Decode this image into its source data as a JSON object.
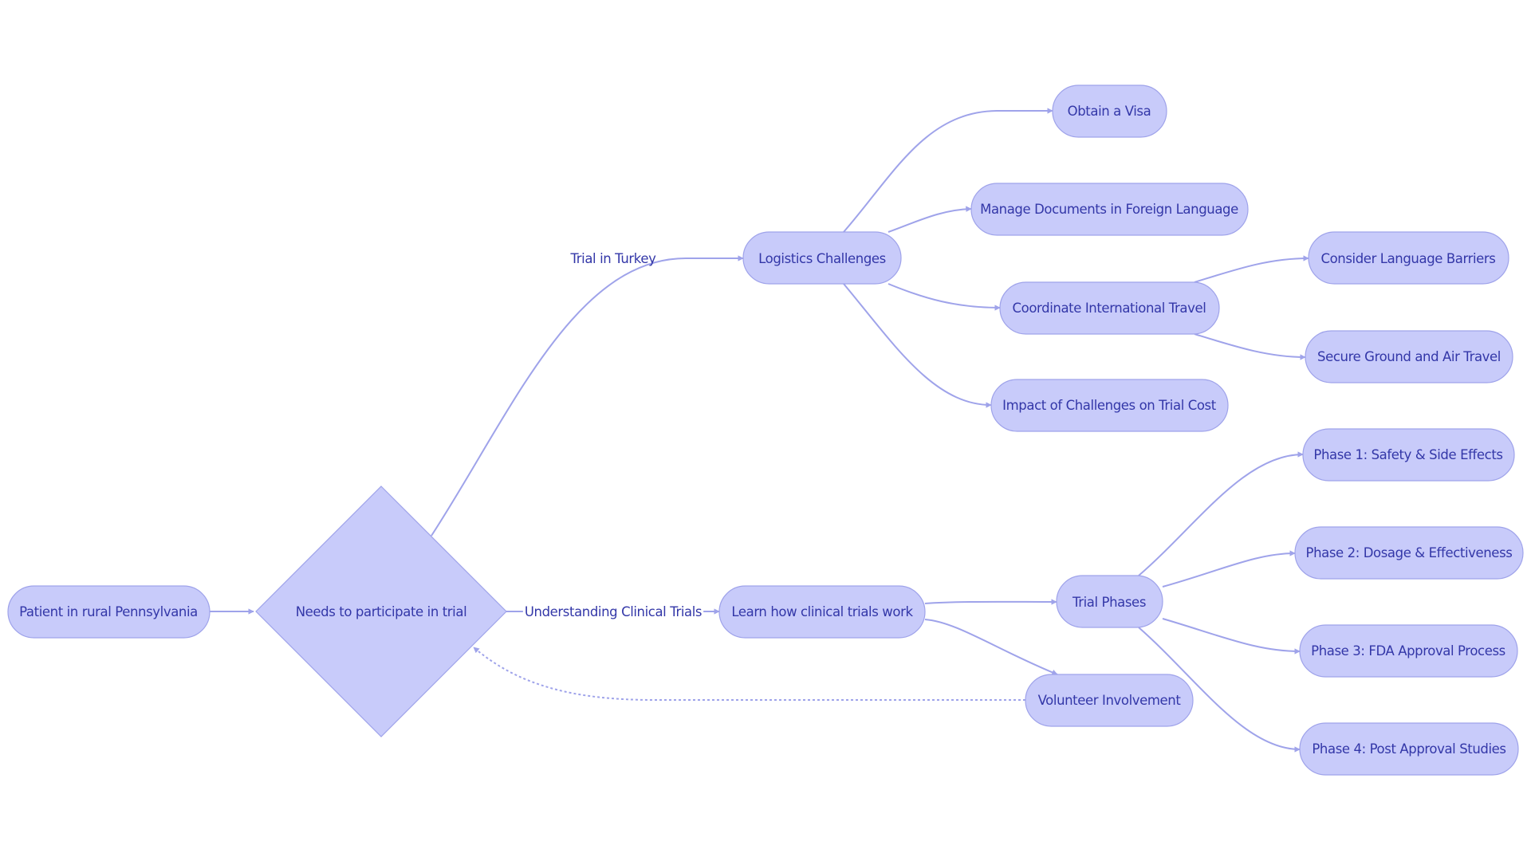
{
  "diagram": {
    "type": "flowchart",
    "colors": {
      "node_fill": "#c8cbfa",
      "node_stroke": "#9fa3ea",
      "edge": "#9fa3ea",
      "text": "#3337a8",
      "background": "#ffffff"
    },
    "nodes": {
      "patient": {
        "label": "Patient in rural Pennsylvania",
        "shape": "stadium"
      },
      "decision": {
        "label": "Needs to participate in trial",
        "shape": "diamond"
      },
      "logistics": {
        "label": "Logistics Challenges",
        "shape": "stadium"
      },
      "learn": {
        "label": "Learn how clinical trials work",
        "shape": "stadium"
      },
      "visa": {
        "label": "Obtain a Visa",
        "shape": "stadium"
      },
      "documents": {
        "label": "Manage Documents in Foreign Language",
        "shape": "stadium"
      },
      "coordinate": {
        "label": "Coordinate International Travel",
        "shape": "stadium"
      },
      "impact": {
        "label": "Impact of Challenges on Trial Cost",
        "shape": "stadium"
      },
      "language": {
        "label": "Consider Language Barriers",
        "shape": "stadium"
      },
      "secure": {
        "label": "Secure Ground and Air Travel",
        "shape": "stadium"
      },
      "phases": {
        "label": "Trial Phases",
        "shape": "stadium"
      },
      "volunteer": {
        "label": "Volunteer Involvement",
        "shape": "stadium"
      },
      "phase1": {
        "label": "Phase 1: Safety & Side Effects",
        "shape": "stadium"
      },
      "phase2": {
        "label": "Phase 2: Dosage & Effectiveness",
        "shape": "stadium"
      },
      "phase3": {
        "label": "Phase 3: FDA Approval Process",
        "shape": "stadium"
      },
      "phase4": {
        "label": "Phase 4: Post Approval Studies",
        "shape": "stadium"
      }
    },
    "edges": [
      {
        "from": "patient",
        "to": "decision",
        "label": "",
        "style": "solid"
      },
      {
        "from": "decision",
        "to": "logistics",
        "label": "Trial in Turkey",
        "style": "solid"
      },
      {
        "from": "decision",
        "to": "learn",
        "label": "Understanding Clinical Trials",
        "style": "solid"
      },
      {
        "from": "logistics",
        "to": "visa",
        "label": "",
        "style": "solid"
      },
      {
        "from": "logistics",
        "to": "documents",
        "label": "",
        "style": "solid"
      },
      {
        "from": "logistics",
        "to": "coordinate",
        "label": "",
        "style": "solid"
      },
      {
        "from": "logistics",
        "to": "impact",
        "label": "",
        "style": "solid"
      },
      {
        "from": "coordinate",
        "to": "language",
        "label": "",
        "style": "solid"
      },
      {
        "from": "coordinate",
        "to": "secure",
        "label": "",
        "style": "solid"
      },
      {
        "from": "learn",
        "to": "phases",
        "label": "",
        "style": "solid"
      },
      {
        "from": "learn",
        "to": "volunteer",
        "label": "",
        "style": "solid"
      },
      {
        "from": "phases",
        "to": "phase1",
        "label": "",
        "style": "solid"
      },
      {
        "from": "phases",
        "to": "phase2",
        "label": "",
        "style": "solid"
      },
      {
        "from": "phases",
        "to": "phase3",
        "label": "",
        "style": "solid"
      },
      {
        "from": "phases",
        "to": "phase4",
        "label": "",
        "style": "solid"
      },
      {
        "from": "volunteer",
        "to": "decision",
        "label": "",
        "style": "dotted"
      }
    ]
  }
}
